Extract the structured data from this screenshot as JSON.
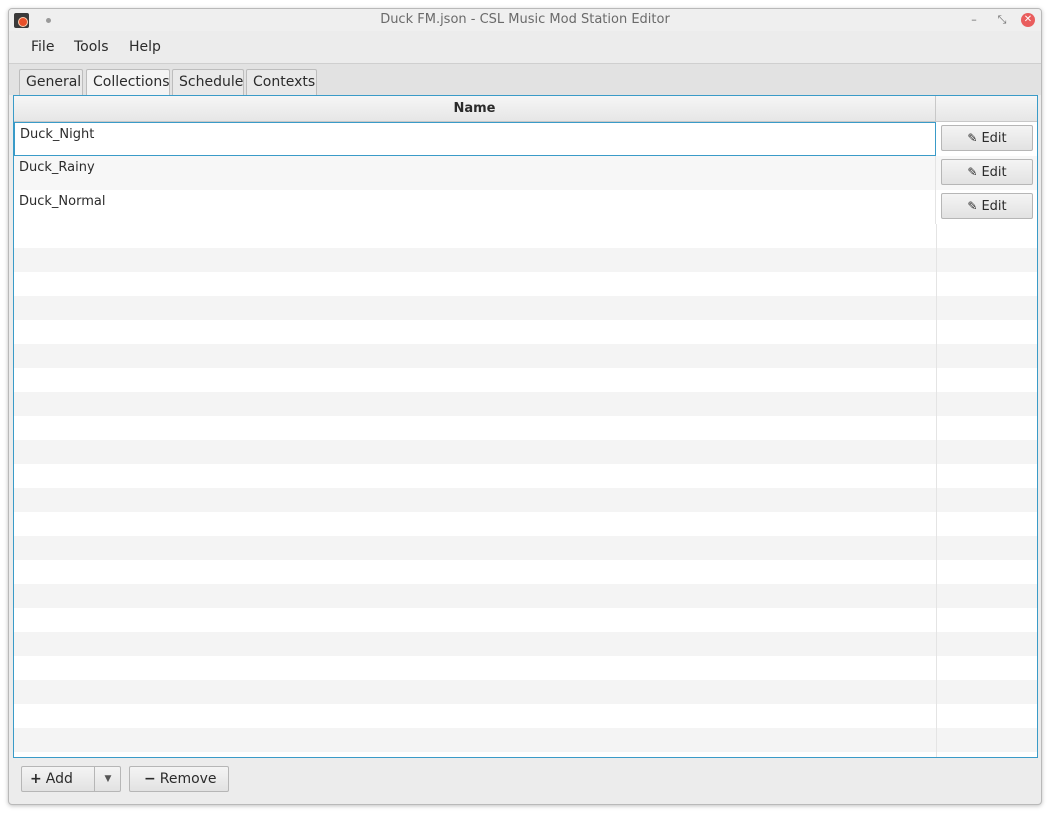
{
  "window": {
    "title": "Duck FM.json - CSL Music Mod Station Editor",
    "controls": {
      "minimize": "–",
      "maximize": "⤡",
      "close": "✕"
    }
  },
  "menu": [
    "File",
    "Tools",
    "Help"
  ],
  "tabs": [
    {
      "label": "General",
      "active": false
    },
    {
      "label": "Collections",
      "active": true
    },
    {
      "label": "Schedule",
      "active": false
    },
    {
      "label": "Contexts",
      "active": false
    }
  ],
  "table": {
    "columns": [
      "Name",
      ""
    ],
    "rows": [
      {
        "name": "Duck_Night",
        "action": "Edit",
        "selected": true
      },
      {
        "name": "Duck_Rainy",
        "action": "Edit",
        "selected": false
      },
      {
        "name": "Duck_Normal",
        "action": "Edit",
        "selected": false
      }
    ]
  },
  "actions": {
    "add_label": "Add",
    "remove_label": "Remove"
  },
  "icons": {
    "app": "app-icon",
    "edit": "pencil-icon",
    "add": "plus-icon",
    "remove": "minus-icon",
    "dropdown": "chevron-down-icon"
  },
  "colors": {
    "accent": "#3a9bc8",
    "close_button": "#e95d5d"
  }
}
